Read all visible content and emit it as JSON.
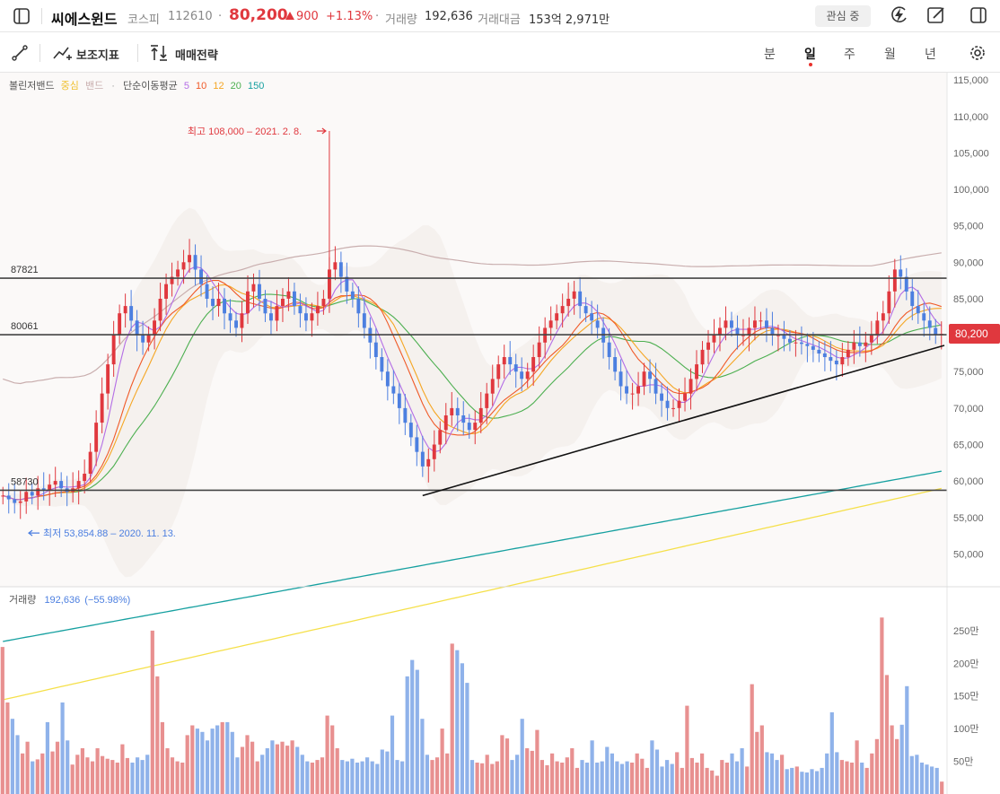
{
  "header": {
    "stock_name": "씨에스윈드",
    "market": "코스피",
    "code": "112610",
    "separator": "·",
    "price": "80,200",
    "change": "900",
    "change_pct": "+1.13%",
    "volume_label": "거래량",
    "volume": "192,636",
    "amount_label": "거래대금",
    "amount": "153억 2,971만",
    "watch_button": "관심 중",
    "icons": [
      "sidebar-toggle-icon",
      "lightning-icon",
      "edit-icon",
      "panel-icon"
    ]
  },
  "toolbar": {
    "draw_icon": "line-draw-icon",
    "indicators_label": "보조지표",
    "strategy_label": "매매전략",
    "periods": [
      "분",
      "일",
      "주",
      "월",
      "년"
    ],
    "active_period": "일",
    "settings_icon": "gear-icon"
  },
  "colors": {
    "up": "#e0383e",
    "down": "#4c7fe0",
    "up_volume": "#e89090",
    "down_volume": "#8fb2ea",
    "ma5": "#b46ee6",
    "ma10": "#f05a28",
    "ma12": "#f5a623",
    "ma20": "#4caf50",
    "ma150": "#16a0a0",
    "bb_upper": "#c9aeae",
    "far_ma": "#f5e04a",
    "price_tag": "#e0383e"
  },
  "indicators": {
    "bollinger": "볼린저밴드",
    "bb_center": "중심",
    "bb_band": "밴드",
    "bullet": "·",
    "ma_label": "단순이동평균",
    "ma_periods": [
      "5",
      "10",
      "12",
      "20",
      "150"
    ]
  },
  "chart_data": {
    "type": "candlestick",
    "y_axis_ticks": [
      "115,000",
      "110,000",
      "105,000",
      "100,000",
      "95,000",
      "90,000",
      "85,000",
      "80,000",
      "75,000",
      "70,000",
      "65,000",
      "60,000",
      "55,000",
      "50,000"
    ],
    "ylim": [
      45500,
      116000
    ],
    "horizontal_lines": [
      {
        "label": "87821",
        "value": 87821
      },
      {
        "label": "80061",
        "value": 80061
      },
      {
        "label": "58730",
        "value": 58730
      }
    ],
    "annotations": {
      "high": "최고 108,000 – 2021. 2. 8.",
      "high_value": 108000,
      "low": "최저 53,854.88 – 2020. 11. 13.",
      "low_value": 53854.88
    },
    "current_price_tag": "80,200",
    "current_price": 80200,
    "price_series": [
      58000,
      57500,
      57000,
      57200,
      58500,
      58000,
      59000,
      58800,
      59500,
      60000,
      59000,
      58500,
      59000,
      60000,
      61000,
      64000,
      68000,
      72000,
      76000,
      80000,
      83000,
      84000,
      82000,
      80000,
      79000,
      80000,
      82000,
      85000,
      87000,
      88000,
      89000,
      90000,
      91000,
      89000,
      87000,
      85000,
      84000,
      85000,
      83000,
      82000,
      81000,
      83000,
      86000,
      87000,
      85000,
      83000,
      82000,
      84000,
      85000,
      86000,
      84000,
      83000,
      82000,
      83000,
      84000,
      85000,
      89000,
      90000,
      88000,
      86000,
      85000,
      83000,
      81000,
      79000,
      77000,
      75000,
      73000,
      72000,
      70000,
      68000,
      66000,
      64000,
      62000,
      63000,
      65000,
      67000,
      69000,
      70000,
      69000,
      68000,
      67000,
      68000,
      70000,
      72000,
      74000,
      76000,
      77000,
      76000,
      75000,
      74000,
      75000,
      77000,
      79000,
      81000,
      82000,
      83000,
      84000,
      85000,
      86000,
      84000,
      83000,
      82000,
      81000,
      79000,
      77000,
      75000,
      73000,
      72000,
      72000,
      73000,
      75000,
      74000,
      72000,
      71000,
      70000,
      70000,
      71000,
      72000,
      74000,
      76000,
      78000,
      79000,
      80000,
      81000,
      82000,
      81000,
      80000,
      80000,
      81000,
      82000,
      82000,
      81000,
      80000,
      80000,
      79500,
      79000,
      79000,
      78800,
      78500,
      78000,
      77500,
      77000,
      76500,
      76000,
      77000,
      78000,
      79000,
      78500,
      79000,
      80000,
      82000,
      83000,
      86000,
      89000,
      88000,
      86000,
      84000,
      83000,
      82000,
      81000,
      80000,
      80200
    ],
    "volume_axis_ticks": [
      "250만",
      "200만",
      "150만",
      "100만",
      "50만"
    ],
    "volume_ylim": [
      0,
      2800000
    ],
    "volume_label": "거래량",
    "volume_value": "192,636",
    "volume_change": "(−55.98%)",
    "volume_series": [
      2250000,
      1400000,
      1150000,
      900000,
      620000,
      800000,
      500000,
      530000,
      620000,
      1100000,
      650000,
      800000,
      1400000,
      820000,
      450000,
      600000,
      700000,
      560000,
      500000,
      700000,
      580000,
      540000,
      520000,
      480000,
      760000,
      550000,
      480000,
      560000,
      520000,
      600000,
      2500000,
      1800000,
      1100000,
      700000,
      560000,
      500000,
      480000,
      900000,
      1050000,
      1000000,
      950000,
      820000,
      1000000,
      1050000,
      1100000,
      1100000,
      950000,
      560000,
      720000,
      900000,
      800000,
      500000,
      600000,
      700000,
      820000,
      760000,
      800000,
      740000,
      820000,
      720000,
      600000,
      500000,
      480000,
      520000,
      560000,
      1200000,
      1050000,
      700000,
      520000,
      500000,
      540000,
      480000,
      500000,
      560000,
      500000,
      460000,
      680000,
      650000,
      1200000,
      520000,
      500000,
      1800000,
      2050000,
      1900000,
      1150000,
      600000,
      520000,
      560000,
      1000000,
      620000,
      2300000,
      2200000,
      2000000,
      1700000,
      520000,
      480000,
      470000,
      600000,
      460000,
      500000,
      900000,
      850000,
      520000,
      600000,
      1150000,
      700000,
      660000,
      980000,
      520000,
      440000,
      620000,
      500000,
      480000,
      560000,
      700000,
      400000,
      520000,
      480000,
      820000,
      480000,
      500000,
      720000,
      620000,
      500000,
      460000,
      500000,
      480000,
      620000,
      540000,
      400000,
      820000,
      680000,
      420000,
      520000,
      460000,
      640000,
      400000,
      1350000,
      550000,
      480000,
      620000,
      400000,
      360000,
      280000,
      520000,
      480000,
      620000,
      500000,
      700000,
      420000,
      1680000,
      950000,
      1050000,
      640000,
      620000,
      520000,
      600000,
      380000,
      400000,
      420000,
      340000,
      330000,
      380000,
      350000,
      400000,
      620000,
      1250000,
      640000,
      520000,
      500000,
      480000,
      820000,
      480000,
      400000,
      620000,
      840000,
      2700000,
      1820000,
      1050000,
      840000,
      1060000,
      1650000,
      580000,
      600000,
      480000,
      450000,
      420000,
      400000,
      190000
    ]
  }
}
